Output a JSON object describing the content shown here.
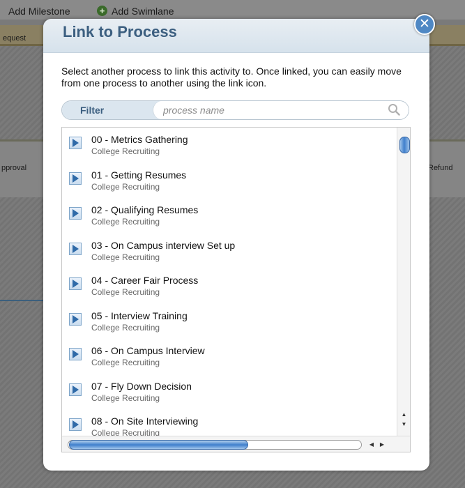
{
  "background": {
    "toolbar": {
      "add_milestone": "Add Milestone",
      "add_swimlane": "Add Swimlane"
    },
    "request_label": "equest",
    "approval_label": "pproval",
    "refund_label": "Refund"
  },
  "dialog": {
    "title": "Link to Process",
    "close_glyph": "✕",
    "description": "Select another process to link this activity to. Once linked, you can easily move from one process to another using the link icon.",
    "filter": {
      "label": "Filter",
      "placeholder": "process name",
      "value": ""
    },
    "processes": [
      {
        "title": "00 - Metrics Gathering",
        "subtitle": "College Recruiting"
      },
      {
        "title": "01 - Getting Resumes",
        "subtitle": "College Recruiting"
      },
      {
        "title": "02 - Qualifying Resumes",
        "subtitle": "College Recruiting"
      },
      {
        "title": "03 - On Campus interview Set up",
        "subtitle": "College Recruiting"
      },
      {
        "title": "04 - Career Fair Process",
        "subtitle": "College Recruiting"
      },
      {
        "title": "05 - Interview Training",
        "subtitle": "College Recruiting"
      },
      {
        "title": "06 - On Campus Interview",
        "subtitle": "College Recruiting"
      },
      {
        "title": "07 - Fly Down Decision",
        "subtitle": "College Recruiting"
      },
      {
        "title": "08 - On Site Interviewing",
        "subtitle": "College Recruiting"
      }
    ]
  },
  "colors": {
    "accent": "#3c5f80",
    "close_button": "#4f88c4",
    "scroll_thumb": "#3f7fcc"
  },
  "icons": {
    "close": "close-icon",
    "search": "search-icon",
    "item": "arrow-right-icon",
    "add": "plus-circle-icon"
  }
}
